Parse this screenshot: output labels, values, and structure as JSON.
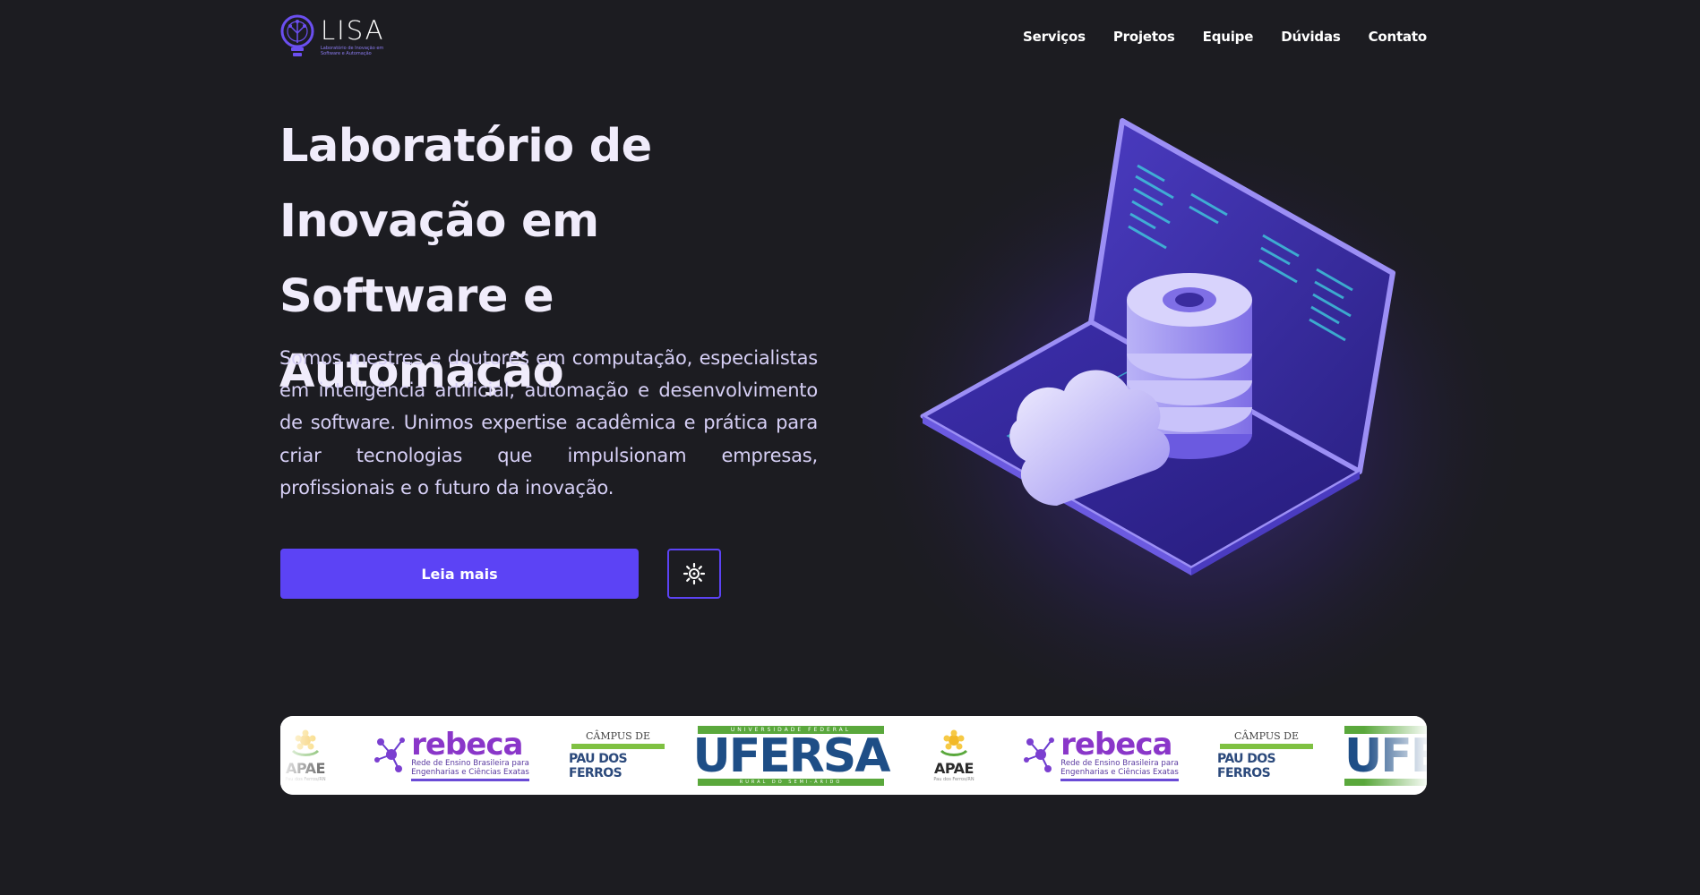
{
  "header": {
    "logo_title": "LISA",
    "logo_subtitle": "Laboratório de Inovação em Software e Automação",
    "nav": [
      {
        "label": "Serviços"
      },
      {
        "label": "Projetos"
      },
      {
        "label": "Equipe"
      },
      {
        "label": "Dúvidas"
      },
      {
        "label": "Contato"
      }
    ]
  },
  "hero": {
    "title": "Laboratório de Inovação em Software e Automação",
    "description": "Somos mestres e doutores em computação, especialistas em inteligência artificial, automação e desenvolvimento de software. Unimos expertise acadêmica e prática para criar tecnologias que impulsionam empresas, profissionais e o futuro da inovação.",
    "cta_label": "Leia mais",
    "theme_toggle_icon": "sun-icon"
  },
  "partners": {
    "apae": {
      "name": "APAE",
      "sub": "Pau dos Ferros/RN"
    },
    "rebeca": {
      "name": "rebeca",
      "sub1": "Rede de Ensino Brasileira para",
      "sub2": "Engenharias e Ciências Exatas"
    },
    "campus": {
      "top": "CÂMPUS DE",
      "bottom": "PAU DOS FERROS"
    },
    "ufersa": {
      "name": "UFERSA",
      "top": "UNIVERSIDADE FEDERAL",
      "bottom": "RURAL DO SEMI-ÁRIDO"
    },
    "ufersa_partial": "UFE"
  },
  "colors": {
    "background": "#1c1c21",
    "accent": "#5c43f5",
    "text": "#f0ecfb"
  }
}
